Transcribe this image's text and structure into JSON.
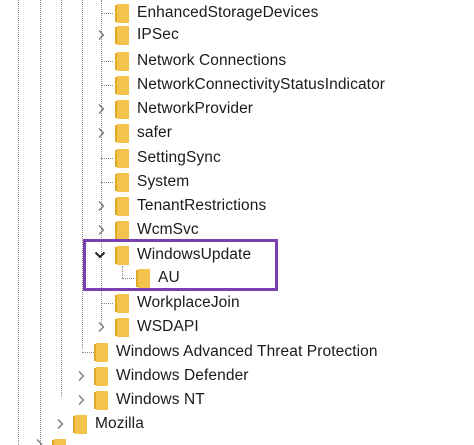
{
  "tree": {
    "items": [
      {
        "label": "EnhancedStorageDevices",
        "expandable": false
      },
      {
        "label": "IPSec",
        "expandable": true
      },
      {
        "label": "Network Connections",
        "expandable": false
      },
      {
        "label": "NetworkConnectivityStatusIndicator",
        "expandable": false
      },
      {
        "label": "NetworkProvider",
        "expandable": true
      },
      {
        "label": "safer",
        "expandable": true
      },
      {
        "label": "SettingSync",
        "expandable": false
      },
      {
        "label": "System",
        "expandable": false
      },
      {
        "label": "TenantRestrictions",
        "expandable": true
      },
      {
        "label": "WcmSvc",
        "expandable": true
      },
      {
        "label": "WindowsUpdate",
        "expandable": true,
        "expanded": true
      },
      {
        "label": "AU",
        "expandable": false
      },
      {
        "label": "WorkplaceJoin",
        "expandable": false
      },
      {
        "label": "WSDAPI",
        "expandable": true
      },
      {
        "label": "Windows Advanced Threat Protection",
        "expandable": false
      },
      {
        "label": "Windows Defender",
        "expandable": true
      },
      {
        "label": "Windows NT",
        "expandable": true
      },
      {
        "label": "Mozilla",
        "expandable": true
      }
    ]
  },
  "colors": {
    "folder_fill": "#f4c34b",
    "folder_back": "#e0a929",
    "highlight_border": "#7a3fb0",
    "text": "#1a1a1a"
  },
  "icons": {
    "folder": "folder-icon",
    "collapsed": "chevron-right-icon",
    "expanded": "chevron-down-icon"
  }
}
